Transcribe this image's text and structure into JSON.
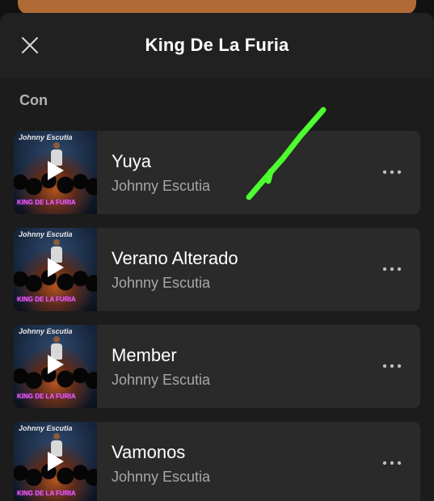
{
  "header": {
    "title": "King De La Furia",
    "close_icon": "close-icon"
  },
  "section_label": "Con",
  "album_art": {
    "artist_lettering": "Johnny Escutia",
    "album_lettering": "KING DE LA FURIA"
  },
  "songs": [
    {
      "title": "Yuya",
      "artist": "Johnny Escutia"
    },
    {
      "title": "Verano Alterado",
      "artist": "Johnny Escutia"
    },
    {
      "title": "Member",
      "artist": "Johnny Escutia"
    },
    {
      "title": "Vamonos",
      "artist": "Johnny Escutia"
    }
  ],
  "colors": {
    "background": "#1c1c1c",
    "row": "#2a2a2a",
    "annotation_stroke": "#4dff2e",
    "secondary_text": "#a7a7a7"
  },
  "icons": {
    "play": "play-icon",
    "more": "more-options-icon"
  }
}
